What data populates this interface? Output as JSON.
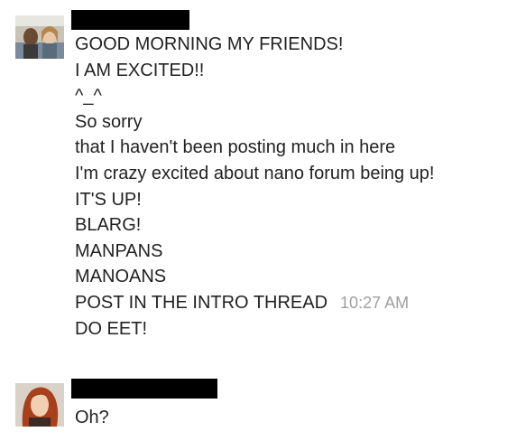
{
  "messages": [
    {
      "sender_name": "",
      "avatar_icon": "user-photo-couple",
      "lines": [
        {
          "text": "GOOD MORNING MY FRIENDS!"
        },
        {
          "text": "I AM EXCITED!!"
        },
        {
          "text": "^_^"
        },
        {
          "text": "So sorry"
        },
        {
          "text": "that I haven't been posting much in here"
        },
        {
          "text": "I'm crazy excited about nano forum being up!"
        },
        {
          "text": "IT'S UP!"
        },
        {
          "text": "BLARG!"
        },
        {
          "text": "MANPANS"
        },
        {
          "text": "MANOANS"
        },
        {
          "text": "POST IN THE INTRO THREAD",
          "timestamp": "10:27 AM"
        },
        {
          "text": "DO EET!"
        }
      ]
    },
    {
      "sender_name": "",
      "avatar_icon": "user-photo-redhead",
      "lines": [
        {
          "text": "Oh?"
        }
      ]
    }
  ],
  "colors": {
    "text": "#222222",
    "timestamp": "#a0a0a0",
    "redaction": "#000000",
    "background": "#ffffff"
  }
}
